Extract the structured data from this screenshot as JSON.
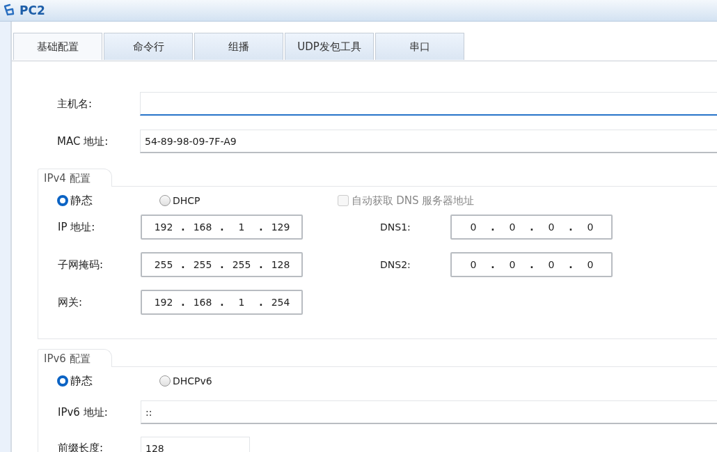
{
  "window": {
    "title": "PC2"
  },
  "tabs": [
    {
      "label": "基础配置",
      "selected": true
    },
    {
      "label": "命令行",
      "selected": false
    },
    {
      "label": "组播",
      "selected": false
    },
    {
      "label": "UDP发包工具",
      "selected": false
    },
    {
      "label": "串口",
      "selected": false
    }
  ],
  "hostname": {
    "label": "主机名:",
    "focused": true
  },
  "mac": {
    "label": "MAC 地址:",
    "value": "54-89-98-09-7F-A9"
  },
  "separator": ".",
  "ipv4": {
    "title": "IPv4 配置",
    "modes": [
      {
        "label": "静态",
        "selected": true
      },
      {
        "label": "DHCP",
        "selected": false
      }
    ],
    "auto_dns": {
      "label": "自动获取 DNS 服务器地址",
      "checked": false,
      "disabled": true
    },
    "rows": [
      {
        "label": "IP 地址:",
        "octets": [
          "192",
          "168",
          "1",
          "129"
        ],
        "dns_label": "DNS1:",
        "dns_octets": [
          "0",
          "0",
          "0",
          "0"
        ]
      },
      {
        "label": "子网掩码:",
        "octets": [
          "255",
          "255",
          "255",
          "128"
        ],
        "dns_label": "DNS2:",
        "dns_octets": [
          "0",
          "0",
          "0",
          "0"
        ]
      },
      {
        "label": "网关:",
        "octets": [
          "192",
          "168",
          "1",
          "254"
        ]
      }
    ]
  },
  "ipv6": {
    "title": "IPv6 配置",
    "modes": [
      {
        "label": "静态",
        "selected": true
      },
      {
        "label": "DHCPv6",
        "selected": false
      }
    ],
    "address": {
      "label": "IPv6 地址:",
      "value": "::"
    },
    "prefix": {
      "label": "前缀长度:",
      "value": "128"
    }
  }
}
